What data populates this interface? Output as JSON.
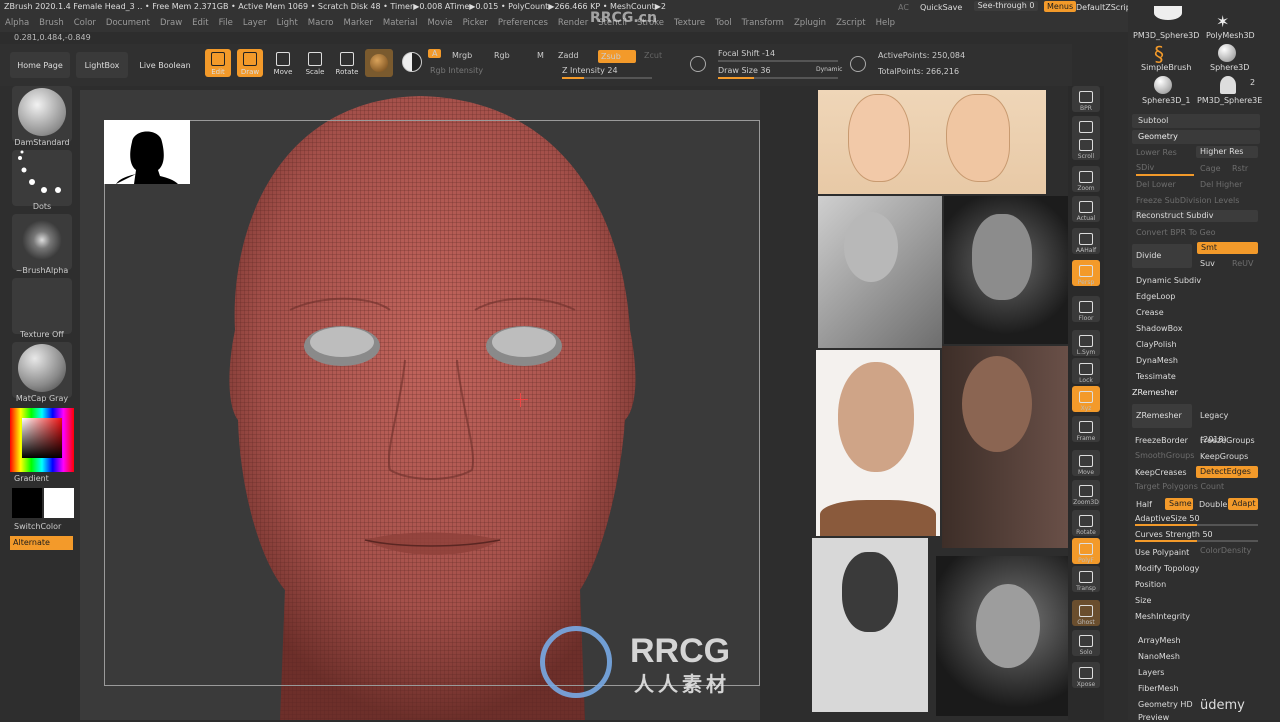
{
  "title_bar": {
    "text": "ZBrush 2020.1.4   Female Head_3   .. • Free Mem 2.371GB • Active Mem 1069 • Scratch Disk 48 • Timer▶0.008 ATime▶0.015 • PolyCount▶266.466 KP • MeshCount▶2",
    "ac": "AC",
    "quicksave": "QuickSave",
    "seethrough": "See-through  0",
    "menus": "Menus",
    "script": "DefaultZScript"
  },
  "menu": [
    "Alpha",
    "Brush",
    "Color",
    "Document",
    "Draw",
    "Edit",
    "File",
    "Layer",
    "Light",
    "Macro",
    "Marker",
    "Material",
    "Movie",
    "Picker",
    "Preferences",
    "Render",
    "Stencil",
    "Stroke",
    "Texture",
    "Tool",
    "Transform",
    "Zplugin",
    "Zscript",
    "Help"
  ],
  "coords": "0.281,0.484,-0.849",
  "toolbar": {
    "home": "Home Page",
    "lightbox": "LightBox",
    "live_boolean": "Live Boolean",
    "edit": "Edit",
    "draw": "Draw",
    "move": "Move",
    "scale": "Scale",
    "rotate": "Rotate",
    "a": "A",
    "mrgb": "Mrgb",
    "rgb": "Rgb",
    "m": "M",
    "zadd": "Zadd",
    "zsub": "Zsub",
    "zcut": "Zcut",
    "rgb_intensity": "Rgb Intensity",
    "z_intensity": "Z Intensity 24",
    "focal_shift": "Focal Shift -14",
    "draw_size": "Draw Size 36",
    "dynamic": "Dynamic",
    "active_points": "ActivePoints: 250,084",
    "total_points": "TotalPoints: 266,216",
    "z_intensity_level": 0.24,
    "draw_size_level": 0.3
  },
  "left_shelf": {
    "brush": "DamStandard",
    "stroke": "Dots",
    "alpha": "~BrushAlpha",
    "texture": "Texture Off",
    "material": "MatCap Gray",
    "gradient": "Gradient",
    "switchcolor": "SwitchColor",
    "alternate": "Alternate"
  },
  "right_bar": [
    "BPR",
    "SPix 3",
    "Scroll",
    "Zoom",
    "Actual",
    "AAHalf",
    "Persp",
    "Floor",
    "L.Sym",
    "Lock",
    "Xyz",
    "Frame",
    "Move",
    "Zoom3D",
    "Rotate",
    "PolyF",
    "Transp",
    "Ghost",
    "Solo",
    "Xpose"
  ],
  "right_panel": {
    "tools": [
      "PM3D_Sphere3D",
      "PolyMesh3D",
      "SimpleBrush",
      "Sphere3D",
      "Sphere3D_1",
      "PM3D_Sphere3E"
    ],
    "tool_count": "2",
    "subtool": "Subtool",
    "geometry": "Geometry",
    "lower_res": "Lower Res",
    "higher_res": "Higher Res",
    "sdiv": "SDiv",
    "cage": "Cage",
    "rstr": "Rstr",
    "del_lower": "Del Lower",
    "del_higher": "Del Higher",
    "freeze_subdiv": "Freeze SubDivision Levels",
    "reconstruct": "Reconstruct Subdiv",
    "convert_bpr": "Convert BPR To Geo",
    "divide": "Divide",
    "smt": "Smt",
    "suv": "Suv",
    "reuv": "ReUV",
    "dynamic_subdiv": "Dynamic Subdiv",
    "edgeloop": "EdgeLoop",
    "crease": "Crease",
    "shadowbox": "ShadowBox",
    "claypolish": "ClayPolish",
    "dynamesh": "DynaMesh",
    "tessimate": "Tessimate",
    "zremesher_header": "ZRemesher",
    "zremesher_btn": "ZRemesher",
    "legacy": "Legacy (2018)",
    "freezeborder": "FreezeBorder",
    "freezegroups": "FreezeGroups",
    "smoothgroups": "SmoothGroups",
    "keepgroups": "KeepGroups",
    "keepcreases": "KeepCreases",
    "detectedges": "DetectEdges",
    "target_poly": "Target Polygons Count",
    "half": "Half",
    "same": "Same",
    "double": "Double",
    "adapt": "Adapt",
    "adaptive_size": "AdaptiveSize 50",
    "curves_strength": "Curves Strength 50",
    "adaptive_size_level": 0.5,
    "curves_strength_level": 0.5,
    "use_polypaint": "Use Polypaint",
    "color_density": "ColorDensity",
    "modify_topology": "Modify Topology",
    "position": "Position",
    "size": "Size",
    "meshintegrity": "MeshIntegrity",
    "arraymesh": "ArrayMesh",
    "nanomesh": "NanoMesh",
    "layers": "Layers",
    "fibermesh": "FiberMesh",
    "geometry_hd": "Geometry HD",
    "preview": "Preview"
  },
  "watermark": {
    "big": "RRCG",
    "small": "人人素材",
    "top": "RRCG.cn",
    "udemy": "üdemy"
  },
  "colors": {
    "accent": "#f39a2a",
    "mesh": "#b65a53",
    "bg": "#2d2d2d"
  }
}
